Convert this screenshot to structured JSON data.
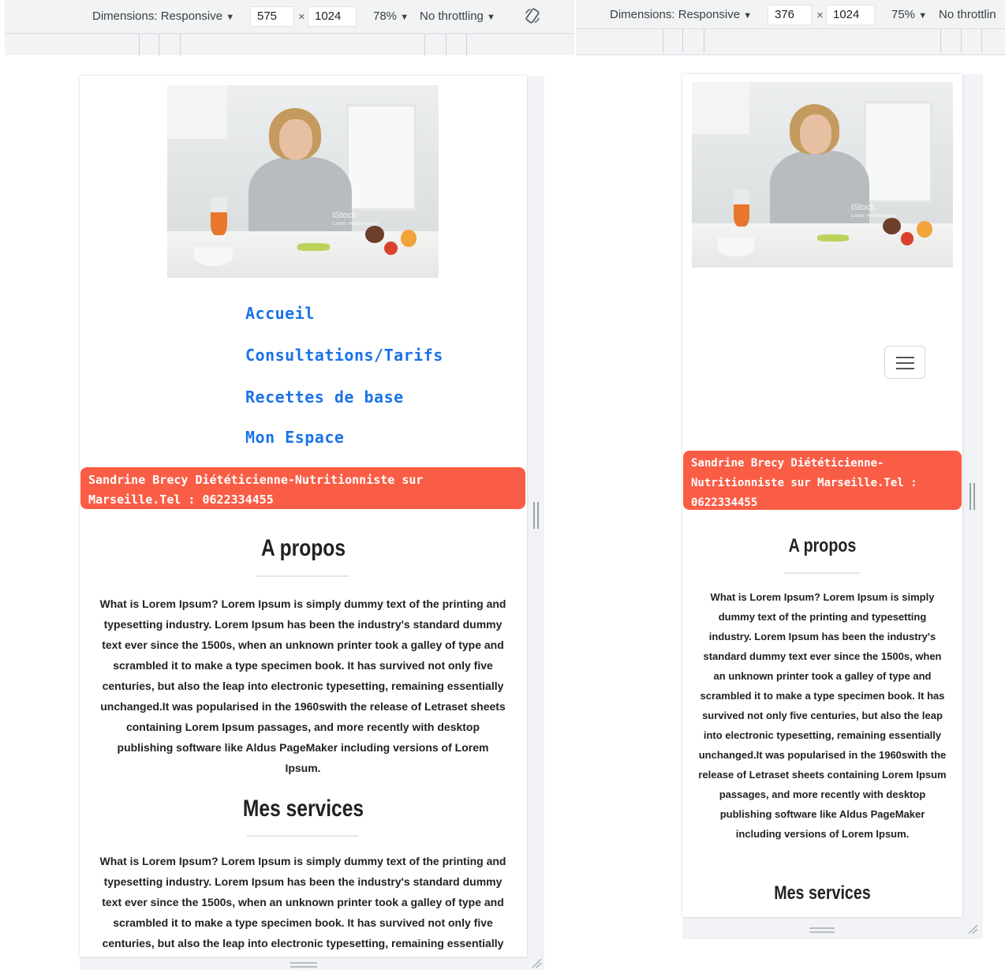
{
  "devtools_left": {
    "dimensions_label": "Dimensions: Responsive",
    "width": "575",
    "times": "×",
    "height": "1024",
    "zoom": "78%",
    "throttling": "No throttling",
    "dropdown_arrow": "▼"
  },
  "devtools_right": {
    "dimensions_label": "Dimensions: Responsive",
    "width": "376",
    "times": "×",
    "height": "1024",
    "zoom": "75%",
    "throttling": "No throttlin",
    "dropdown_arrow": "▼"
  },
  "hero": {
    "watermark": "iStock",
    "credit": "Credit: PeopleImages"
  },
  "nav": {
    "items": [
      "Accueil",
      "Consultations/Tarifs",
      "Recettes de base",
      "Mon Espace"
    ]
  },
  "banner_text": "Sandrine Brecy Diététicienne-Nutritionniste sur Marseille.Tel : 0622334455",
  "sections": {
    "about_title": "A propos",
    "about_text": "What is Lorem Ipsum? Lorem Ipsum is simply dummy text of the printing and typesetting industry. Lorem Ipsum has been the industry's standard dummy text ever since the 1500s, when an unknown printer took a galley of type and scrambled it to make a type specimen book. It has survived not only five centuries, but also the leap into electronic typesetting, remaining essentially unchanged.It was popularised in the 1960swith the release of Letraset sheets containing Lorem Ipsum passages, and more recently with desktop publishing software like Aldus PageMaker including versions of Lorem Ipsum.",
    "services_title": "Mes services",
    "services_text": "What is Lorem Ipsum? Lorem Ipsum is simply dummy text of the printing and typesetting industry. Lorem Ipsum has been the industry's standard dummy text ever since the 1500s, when an unknown printer took a galley of type and scrambled it to make a type specimen book. It has survived not only five centuries, but also the leap into electronic typesetting, remaining essentially"
  },
  "icons": {
    "rotate": "rotate-icon",
    "hamburger": "hamburger-menu-icon",
    "resize_grip": "resize-grip-icon"
  },
  "colors": {
    "banner": "#f95d45",
    "nav_link": "#1a73e8",
    "devtools_bg": "#f1f3f4"
  }
}
